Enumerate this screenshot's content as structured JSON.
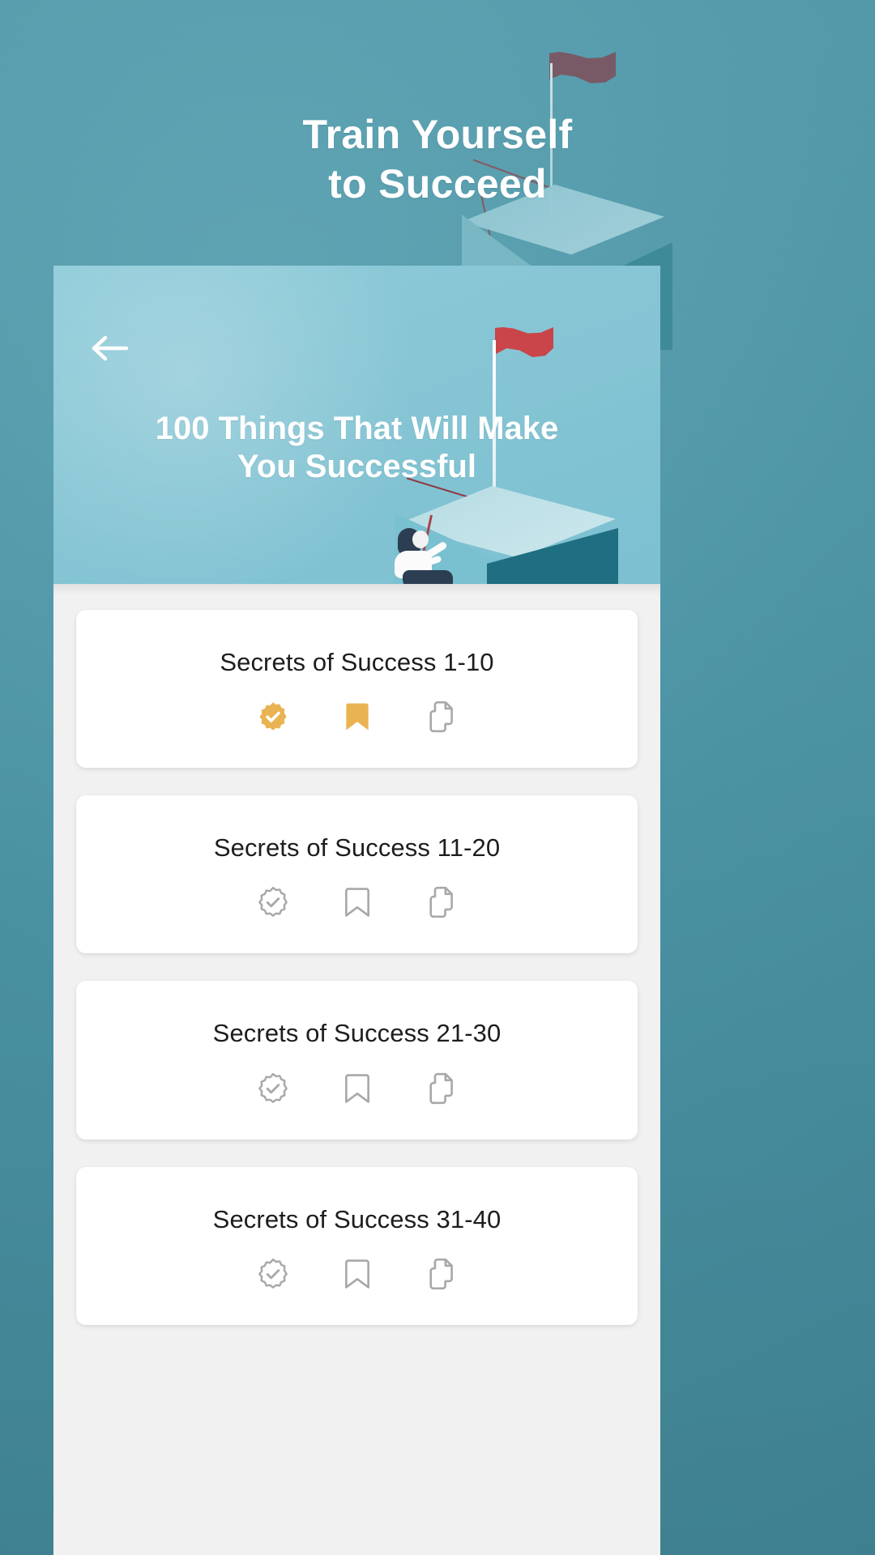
{
  "splash": {
    "title_line1": "Train Yourself",
    "title_line2": "to Succeed",
    "bg_color": "#4b95a6",
    "flag_color": "#7b5560"
  },
  "app": {
    "hero": {
      "back_icon": "arrow-left-icon",
      "title_line1": "100 Things That Will Make",
      "title_line2": "You Successful",
      "bg_color": "#86c5d4",
      "flag_color": "#c9454a",
      "pedestal_dark_color": "#1f6e81"
    },
    "list": {
      "bg_color": "#f1f1f1",
      "active_icon_color": "#eab352",
      "inactive_icon_color": "#a8a8a8",
      "cards": [
        {
          "title": "Secrets of Success 1-10",
          "actions": [
            {
              "icon": "verified-badge-icon",
              "state": "active",
              "color": "#eab352"
            },
            {
              "icon": "bookmark-icon",
              "state": "active",
              "color": "#eab352"
            },
            {
              "icon": "copy-documents-icon",
              "state": "inactive",
              "color": "#a8a8a8"
            }
          ]
        },
        {
          "title": "Secrets of Success 11-20",
          "actions": [
            {
              "icon": "verified-badge-icon",
              "state": "inactive",
              "color": "#a8a8a8"
            },
            {
              "icon": "bookmark-icon",
              "state": "inactive",
              "color": "#a8a8a8"
            },
            {
              "icon": "copy-documents-icon",
              "state": "inactive",
              "color": "#a8a8a8"
            }
          ]
        },
        {
          "title": "Secrets of Success 21-30",
          "actions": [
            {
              "icon": "verified-badge-icon",
              "state": "inactive",
              "color": "#a8a8a8"
            },
            {
              "icon": "bookmark-icon",
              "state": "inactive",
              "color": "#a8a8a8"
            },
            {
              "icon": "copy-documents-icon",
              "state": "inactive",
              "color": "#a8a8a8"
            }
          ]
        },
        {
          "title": "Secrets of Success 31-40",
          "actions": [
            {
              "icon": "verified-badge-icon",
              "state": "inactive",
              "color": "#a8a8a8"
            },
            {
              "icon": "bookmark-icon",
              "state": "inactive",
              "color": "#a8a8a8"
            },
            {
              "icon": "copy-documents-icon",
              "state": "inactive",
              "color": "#a8a8a8"
            }
          ]
        }
      ]
    }
  }
}
